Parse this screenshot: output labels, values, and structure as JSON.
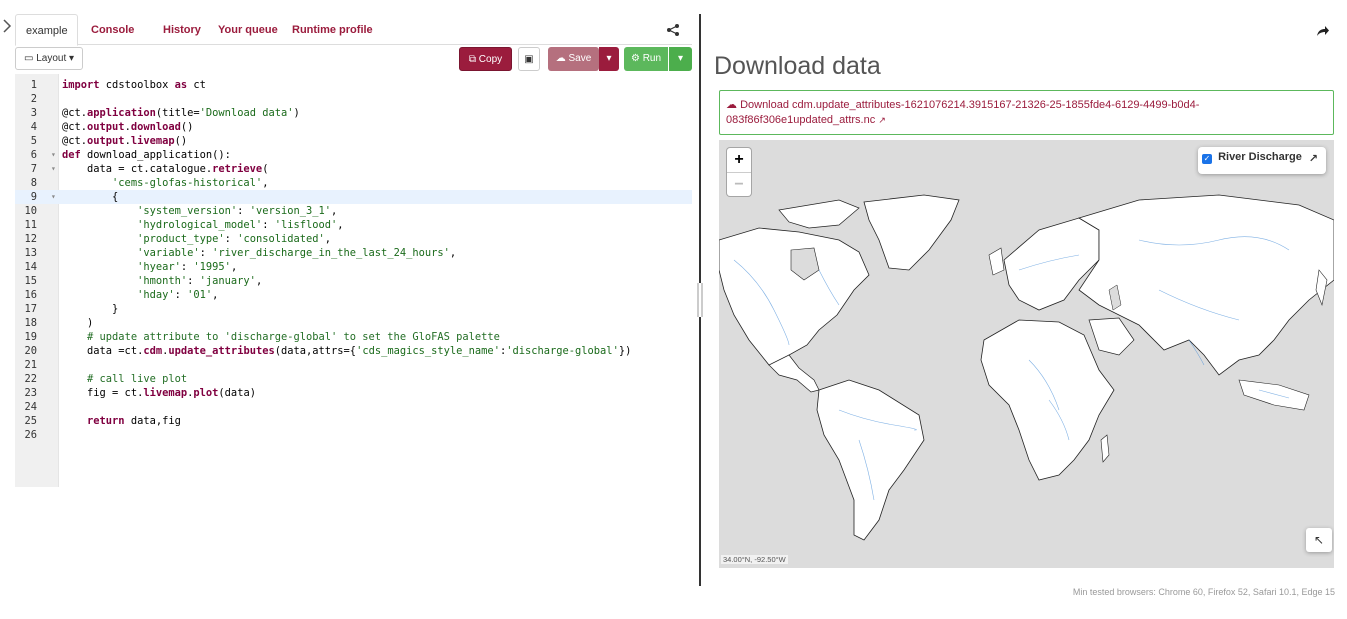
{
  "tabs": [
    {
      "label": "example"
    },
    {
      "label": "Console"
    },
    {
      "label": "History"
    },
    {
      "label": "Your queue"
    },
    {
      "label": "Runtime profile"
    }
  ],
  "toolbar": {
    "layout_label": "Layout",
    "copy_label": "Copy",
    "save_label": "Save",
    "run_label": "Run"
  },
  "editor": {
    "active_line": 9,
    "lines": [
      "import cdstoolbox as ct",
      "",
      "@ct.application(title='Download data')",
      "@ct.output.download()",
      "@ct.output.livemap()",
      "def download_application():",
      "    data = ct.catalogue.retrieve(",
      "        'cems-glofas-historical',",
      "        {",
      "            'system_version': 'version_3_1',",
      "            'hydrological_model': 'lisflood',",
      "            'product_type': 'consolidated',",
      "            'variable': 'river_discharge_in_the_last_24_hours',",
      "            'hyear': '1995',",
      "            'hmonth': 'january',",
      "            'hday': '01',",
      "        }",
      "    )",
      "    # update attribute to 'discharge-global' to set the GloFAS palette",
      "    data =ct.cdm.update_attributes(data,attrs={'cds_magics_style_name':'discharge-global'})",
      "",
      "    # call live plot",
      "    fig = ct.livemap.plot(data)",
      "",
      "    return data,fig",
      ""
    ],
    "fold_lines": [
      6,
      7,
      9
    ]
  },
  "output": {
    "title": "Download data",
    "download_text": "Download cdm.update_attributes-1621076214.3915167-21326-25-1855fde4-6129-4499-b0d4-083f86f306e1updated_attrs.nc"
  },
  "map": {
    "zoom_in": "+",
    "zoom_out": "−",
    "layer_label": "River Discharge",
    "layer_checked": true,
    "coords": "34.00°N, -92.50°W"
  },
  "footer": "Min tested browsers: Chrome 60, Firefox 52, Safari 10.1, Edge 15",
  "colors": {
    "accent": "#9b1c3d",
    "run": "#5cb85c",
    "ocean": "#dcdcdc",
    "rivers": "#4a90d9"
  }
}
